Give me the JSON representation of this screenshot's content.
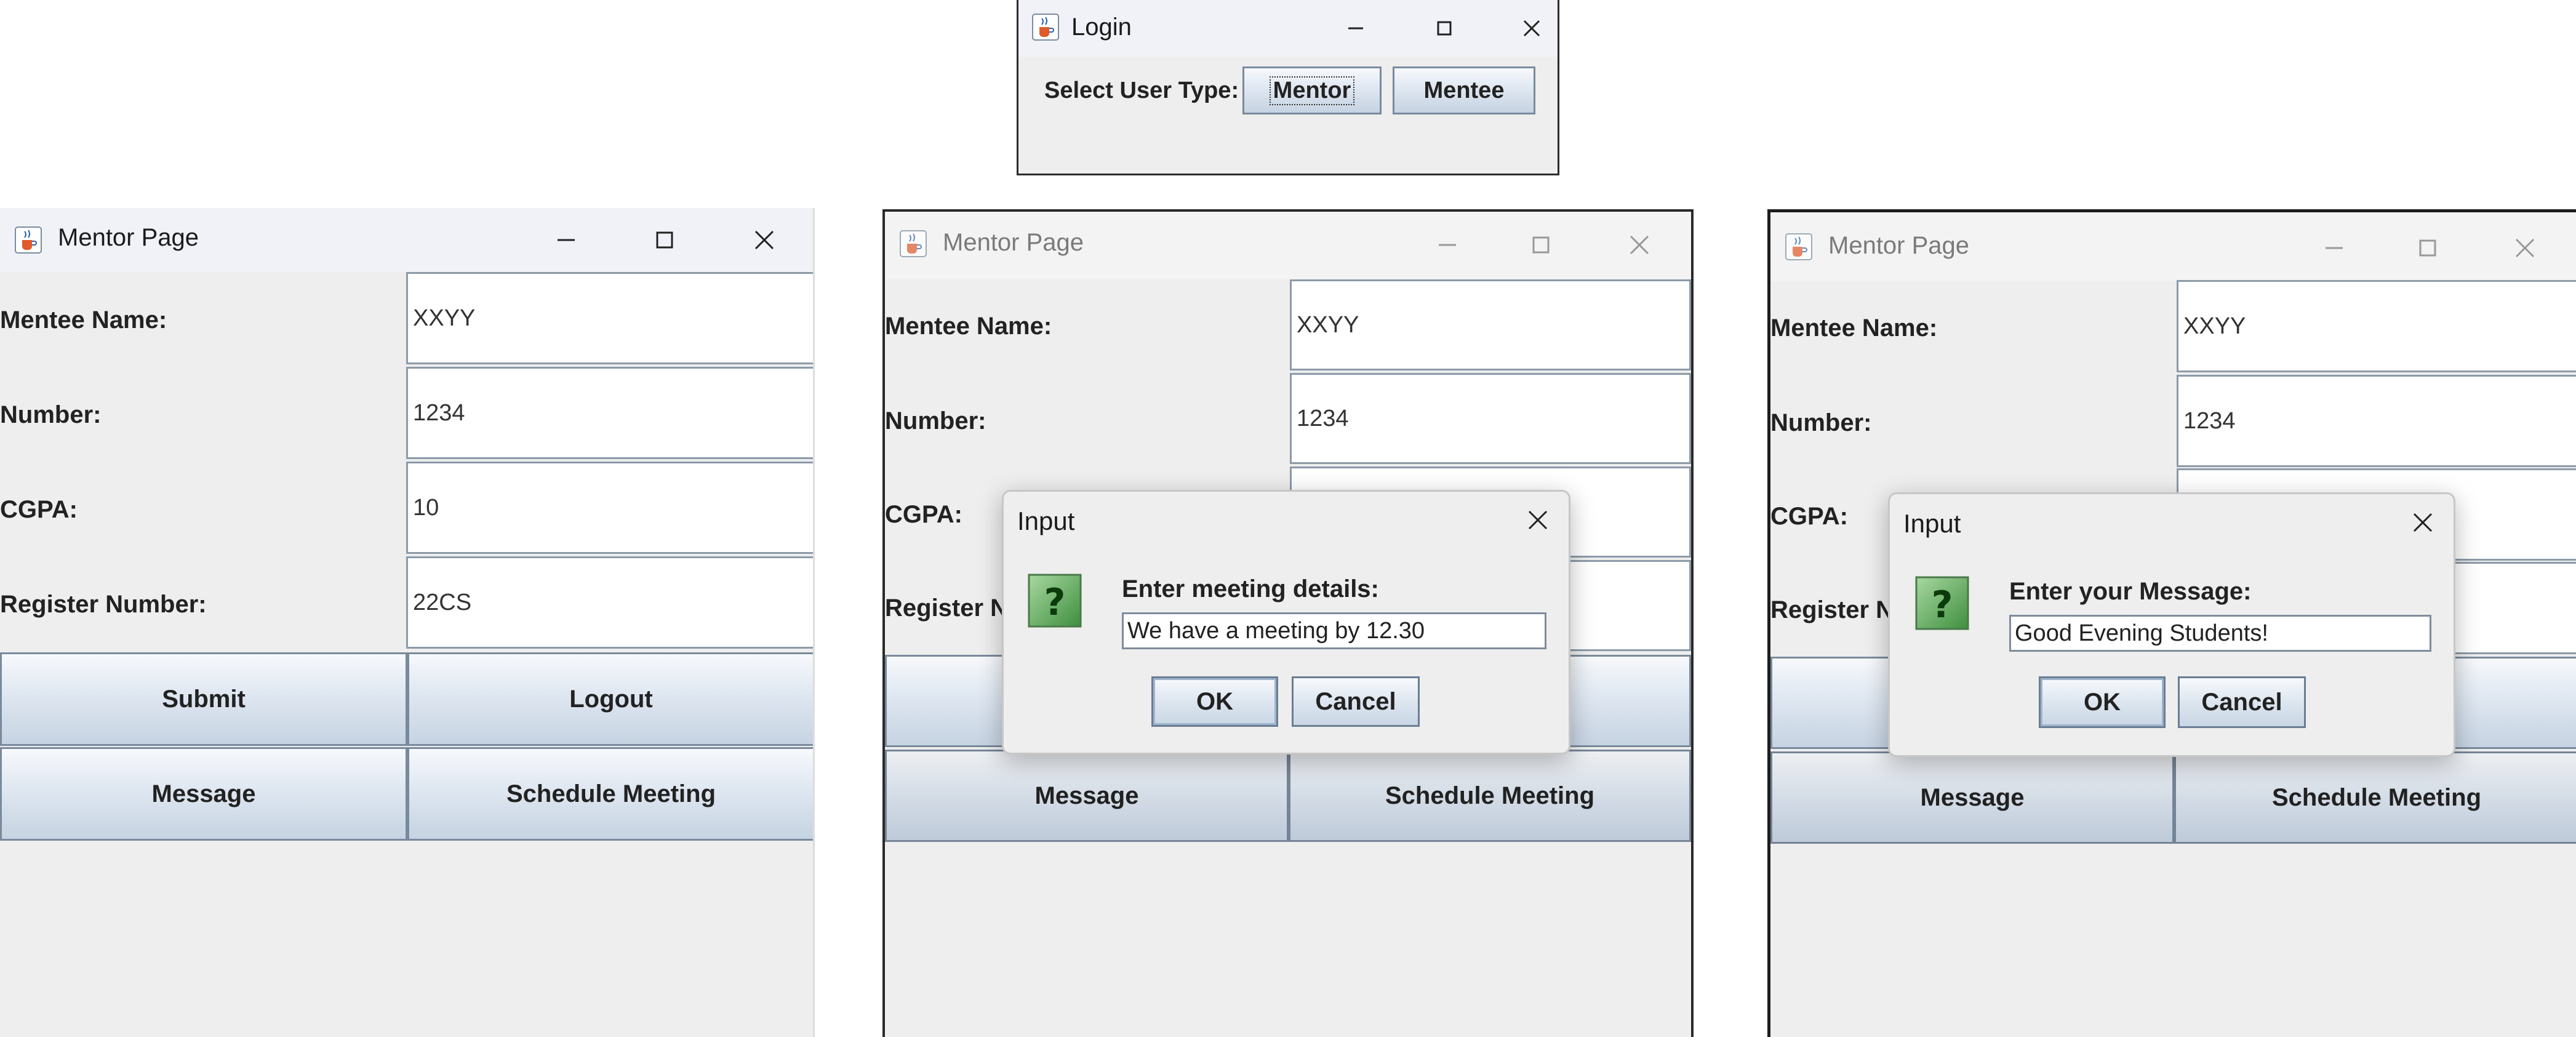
{
  "login": {
    "title": "Login",
    "select_label": "Select User Type:",
    "mentor_button": "Mentor",
    "mentee_button": "Mentee"
  },
  "mentor_page": {
    "title": "Mentor Page",
    "labels": {
      "mentee_name": "Mentee Name:",
      "number": "Number:",
      "cgpa": "CGPA:",
      "register_number": "Register Number:",
      "register_number_clipped": "Register N"
    },
    "values": {
      "mentee_name": "XXYY",
      "number": "1234",
      "cgpa": "10",
      "register_number": "22CS"
    },
    "buttons": {
      "submit": "Submit",
      "logout": "Logout",
      "message": "Message",
      "schedule_meeting": "Schedule Meeting"
    }
  },
  "meeting_dialog": {
    "title": "Input",
    "prompt": "Enter meeting details:",
    "value": "We have a meeting by 12.30",
    "ok": "OK",
    "cancel": "Cancel"
  },
  "message_dialog": {
    "title": "Input",
    "prompt": "Enter your Message:",
    "value": "Good Evening Students!",
    "ok": "OK",
    "cancel": "Cancel"
  },
  "colors": {
    "window_bg": "#eeeeee",
    "button_gradient_top": "#f7f9fc",
    "button_gradient_bottom": "#c6d3e2",
    "question_icon_green": "#5aa85a"
  },
  "icons": [
    "java-cup-icon",
    "minimize-icon",
    "maximize-icon",
    "close-icon",
    "question-icon"
  ]
}
